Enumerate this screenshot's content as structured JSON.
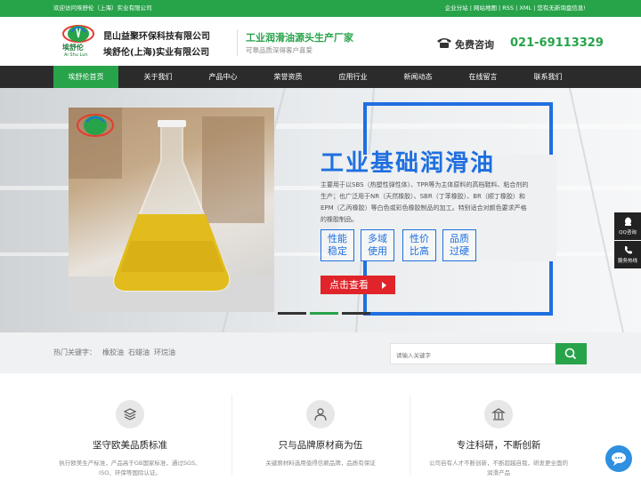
{
  "topbar": {
    "welcome": "欢迎访问埃舒伦（上海）实业有限公司",
    "links": "企业分站 | 网站地图 | RSS | XML | 您有无新询盘信息!"
  },
  "header": {
    "logo_text": "埃舒伦",
    "logo_sub": "Ai Shu Lun",
    "company1": "昆山益聚环保科技有限公司",
    "company2": "埃舒伦(上海)实业有限公司",
    "slogan": "工业润滑油源头生产厂家",
    "slogan_sub": "可靠品质深得客户喜爱",
    "consult_label": "免费咨询",
    "phone": "021-69113329"
  },
  "nav": {
    "items": [
      "埃舒伦首页",
      "关于我们",
      "产品中心",
      "荣誉资质",
      "应用行业",
      "新闻动态",
      "在线留言",
      "联系我们"
    ],
    "active_index": 0
  },
  "banner": {
    "title": "工业基础润滑油",
    "desc": "主要用于以SBS（热塑性弹性体）、TPR等为主体原料的高档鞋料、粘合剂的生产；也广泛用于NR（天然橡胶）、SBR（丁苯橡胶）、BR（顺丁橡胶）和EPM（乙丙橡胶）等白色或彩色橡胶制品的加工。特别适合对颜色要求严格的橡胶制品。",
    "features": [
      {
        "l1": "性能",
        "l2": "稳定"
      },
      {
        "l1": "多域",
        "l2": "使用"
      },
      {
        "l1": "性价",
        "l2": "比高"
      },
      {
        "l1": "品质",
        "l2": "过硬"
      }
    ],
    "cta": "点击查看",
    "slide_count": 3,
    "active_slide": 2
  },
  "side_tools": [
    {
      "label": "QQ咨询",
      "icon": "qq-icon"
    },
    {
      "label": "服务热线",
      "icon": "phone-icon"
    }
  ],
  "search": {
    "hot_label": "热门关键字：",
    "keywords": [
      "橡胶油",
      "石蜡油",
      "环烷油"
    ],
    "placeholder": "请输入关键字"
  },
  "features": [
    {
      "icon": "layers-icon",
      "title": "坚守欧美品质标准",
      "desc": "执行欧美生产标准，产品高于GB国家标准，通过SGS、ISO、环保等国际认证。"
    },
    {
      "icon": "user-icon",
      "title": "只与品牌原材商为伍",
      "desc": "关键原材料选用值得信赖品牌，品质有保证"
    },
    {
      "icon": "building-icon",
      "title": "专注科研，不断创新",
      "desc": "公司自有人才不断创新，不断超越自我，研发更全面的润滑产品"
    }
  ],
  "colors": {
    "green": "#27a34a",
    "blue": "#1f6fe0",
    "dark": "#2b2b2b",
    "red": "#e0242a"
  }
}
